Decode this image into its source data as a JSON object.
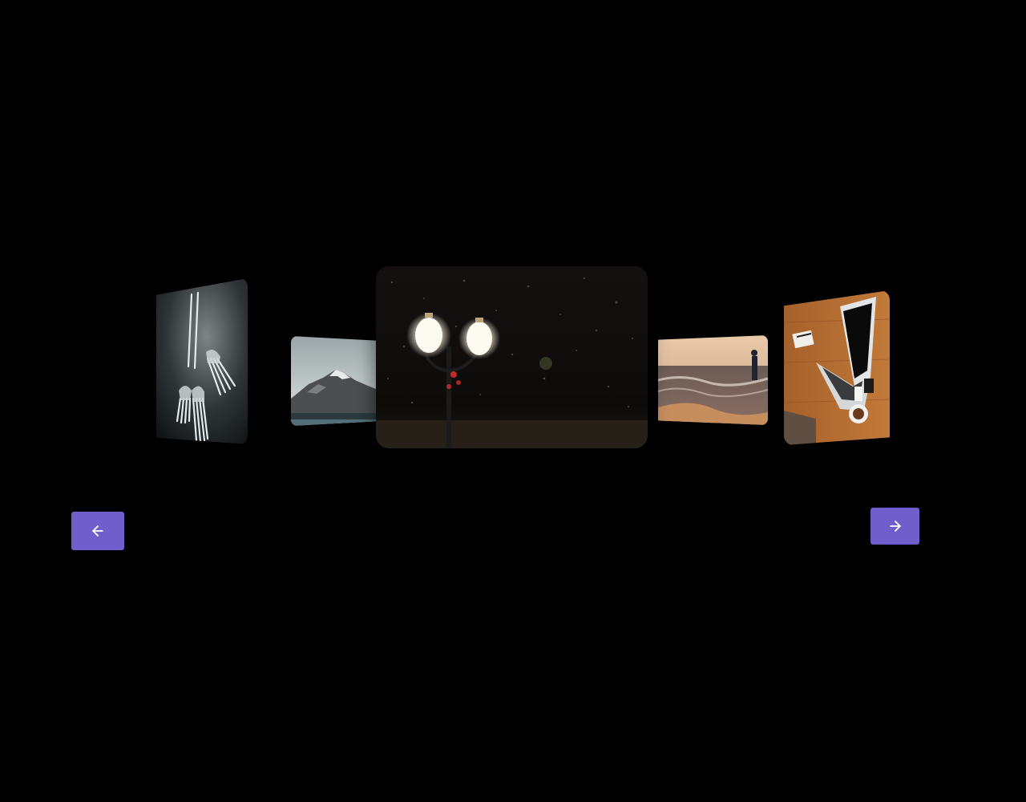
{
  "carousel": {
    "slides": [
      {
        "id": "forks",
        "description": "forks"
      },
      {
        "id": "mountain",
        "description": "mountain"
      },
      {
        "id": "lamp",
        "description": "street lamp",
        "active": true
      },
      {
        "id": "sea",
        "description": "sea"
      },
      {
        "id": "laptop",
        "description": "laptop"
      }
    ],
    "active_index": 2
  },
  "controls": {
    "prev_icon": "arrow-left-icon",
    "next_icon": "arrow-right-icon",
    "accent_color": "#6f5ecb"
  }
}
